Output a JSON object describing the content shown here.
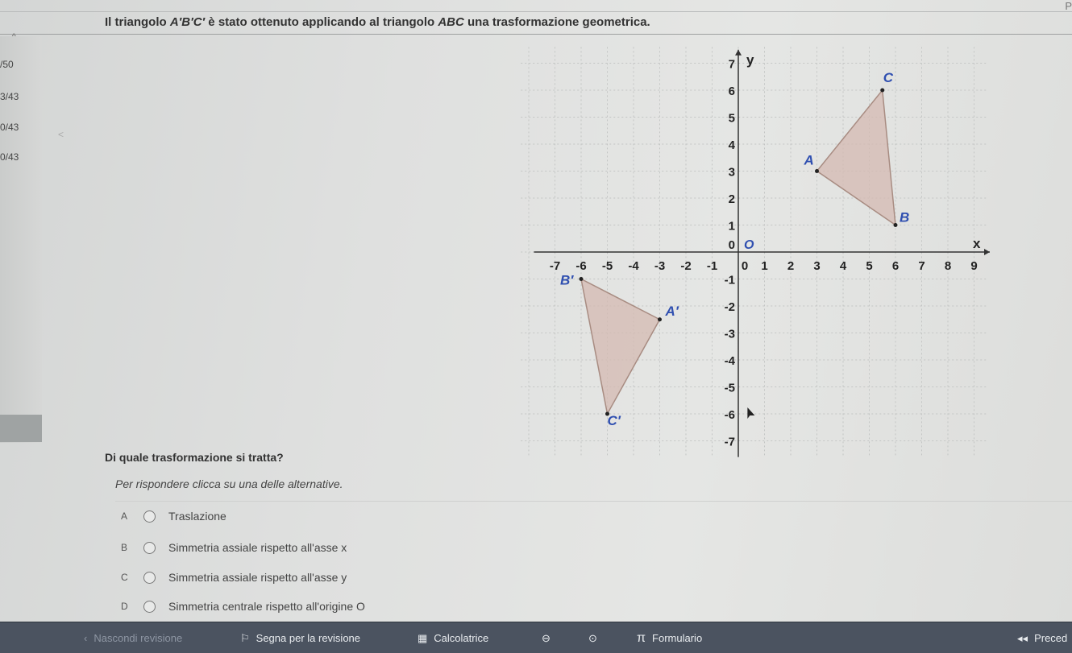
{
  "corner": {
    "text": "P"
  },
  "question": {
    "prefix": "Il triangolo ",
    "shape_prime": "A′B′C′",
    "middle": " è stato ottenuto applicando al triangolo ",
    "shape": "ABC",
    "suffix": " una trasformazione geometrica."
  },
  "sidebar": {
    "collapse": "^",
    "items": [
      {
        "label": "/50"
      },
      {
        "label": "3/43"
      },
      {
        "label": "0/43"
      },
      {
        "label": "0/43"
      }
    ],
    "arrow": "<"
  },
  "graph": {
    "x_axis_label": "x",
    "y_axis_label": "y",
    "origin_label": "O",
    "x_ticks": [
      "-7",
      "-6",
      "-5",
      "-4",
      "-3",
      "-2",
      "-1",
      "0",
      "1",
      "2",
      "3",
      "4",
      "5",
      "6",
      "7",
      "8",
      "9"
    ],
    "y_ticks": [
      "7",
      "6",
      "5",
      "4",
      "3",
      "2",
      "1",
      "0",
      "-1",
      "-2",
      "-3",
      "-4",
      "-5",
      "-6",
      "-7"
    ],
    "triangle": {
      "A": {
        "label": "A",
        "x": 3,
        "y": 3
      },
      "B": {
        "label": "B",
        "x": 6,
        "y": 1
      },
      "C": {
        "label": "C",
        "x": 5.5,
        "y": 6
      },
      "fill": "#d4b9b1",
      "stroke": "#a88c82"
    },
    "triangle_prime": {
      "A": {
        "label": "A′",
        "x": -3,
        "y": -2.5
      },
      "B": {
        "label": "B′",
        "x": -6,
        "y": -1
      },
      "C": {
        "label": "C′",
        "x": -5,
        "y": -6
      },
      "fill": "#d4b9b1",
      "stroke": "#a88c82"
    },
    "label_color": "#2f4fb0"
  },
  "prompt": "Di quale trasformazione si tratta?",
  "instruction": "Per rispondere clicca su una delle alternative.",
  "options": [
    {
      "letter": "A",
      "text": "Traslazione"
    },
    {
      "letter": "B",
      "text": "Simmetria assiale rispetto all'asse x"
    },
    {
      "letter": "C",
      "text": "Simmetria assiale rispetto all'asse y"
    },
    {
      "letter": "D",
      "text": "Simmetria centrale rispetto all'origine O"
    }
  ],
  "toolbar": {
    "hide_review": "Nascondi revisione",
    "flag_review": "Segna per la revisione",
    "calculator": "Calcolatrice",
    "formulary": "Formulario",
    "previous": "Preced"
  }
}
